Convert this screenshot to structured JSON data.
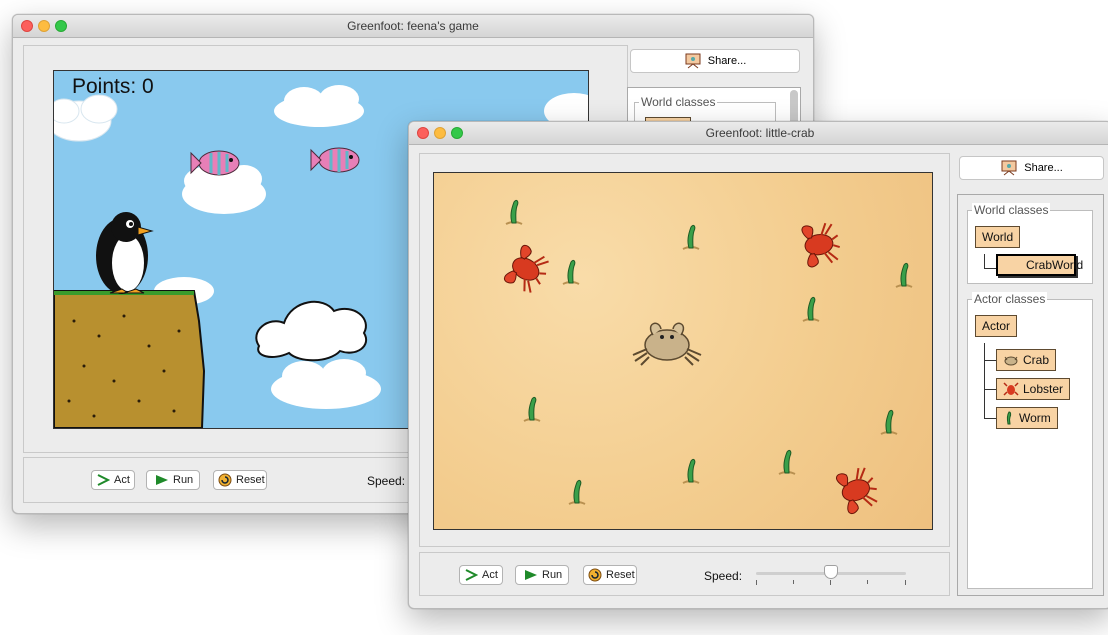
{
  "back_window": {
    "title": "Greenfoot: feena's game",
    "points_text": "Points: 0",
    "share_label": "Share...",
    "world_classes_label": "World classes",
    "act_label": "Act",
    "run_label": "Run",
    "reset_label": "Reset",
    "speed_label": "Speed:"
  },
  "front_window": {
    "title": "Greenfoot: little-crab",
    "share_label": "Share...",
    "world_classes_label": "World classes",
    "world_classes": [
      "World",
      "CrabWorld"
    ],
    "actor_classes_label": "Actor classes",
    "actor_classes": [
      "Actor",
      "Crab",
      "Lobster",
      "Worm"
    ],
    "act_label": "Act",
    "run_label": "Run",
    "reset_label": "Reset",
    "speed_label": "Speed:",
    "speed_fraction": 0.5
  },
  "colors": {
    "class_fill": "#f8d3a4",
    "sand": "#f3cd8f",
    "sky": "#89c9ee",
    "close": "#fc605c",
    "minimize": "#fdbc40",
    "zoom": "#34c84a"
  },
  "icons": [
    "act-icon",
    "run-icon",
    "reset-icon",
    "share-icon",
    "crab-icon",
    "lobster-icon",
    "worm-icon"
  ]
}
